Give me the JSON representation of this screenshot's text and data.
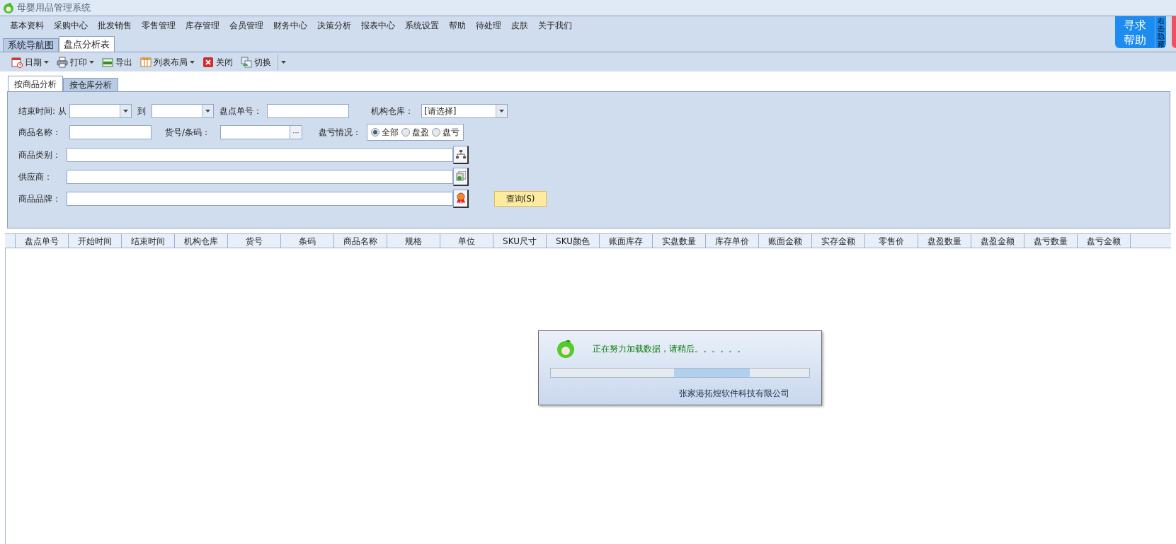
{
  "window": {
    "title": "母婴用品管理系统"
  },
  "menu": [
    "基本资料",
    "采购中心",
    "批发销售",
    "零售管理",
    "库存管理",
    "会员管理",
    "财务中心",
    "决策分析",
    "报表中心",
    "系统设置",
    "帮助",
    "待处理",
    "皮肤",
    "关于我们"
  ],
  "help_button": {
    "lines": [
      "寻求",
      "帮助"
    ],
    "hint": "右击隐藏"
  },
  "doc_tabs": [
    {
      "label": "系统导航图",
      "selected": false
    },
    {
      "label": "盘点分析表",
      "selected": true
    }
  ],
  "toolbar": [
    {
      "label": "日期",
      "kind": "calendar",
      "dropdown": true
    },
    {
      "label": "打印",
      "kind": "printer",
      "dropdown": true
    },
    {
      "label": "导出",
      "kind": "xls",
      "dropdown": false
    },
    {
      "label": "列表布局",
      "kind": "grid",
      "dropdown": true
    },
    {
      "label": "关闭",
      "kind": "close",
      "dropdown": false
    },
    {
      "label": "切换",
      "kind": "switch",
      "dropdown": false
    }
  ],
  "view_tabs": [
    {
      "label": "按商品分析",
      "selected": true
    },
    {
      "label": "按仓库分析",
      "selected": false
    }
  ],
  "filters": {
    "end_time": {
      "label": "结束时间: 从",
      "to_label": "到"
    },
    "count_no": {
      "label": "盘点单号："
    },
    "warehouse": {
      "label": "机构仓库：",
      "value": "[请选择]"
    },
    "product_name": {
      "label": "商品名称："
    },
    "code": {
      "label": "货号/条码：",
      "button": "···"
    },
    "profit_loss": {
      "label": "盘亏情况：",
      "options": [
        {
          "label": "全部",
          "selected": true
        },
        {
          "label": "盘盈",
          "selected": false
        },
        {
          "label": "盘亏",
          "selected": false
        }
      ]
    },
    "pickers": [
      {
        "label": "商品类别：",
        "kind": "tree"
      },
      {
        "label": "供应商：",
        "kind": "list"
      },
      {
        "label": "商品品牌：",
        "kind": "award"
      }
    ],
    "query_button": "查询(S)"
  },
  "table": {
    "columns": [
      "盘点单号",
      "开始时间",
      "结束时间",
      "机构仓库",
      "货号",
      "条码",
      "商品名称",
      "规格",
      "单位",
      "SKU尺寸",
      "SKU颜色",
      "账面库存",
      "实盘数量",
      "库存单价",
      "账面金额",
      "实存金额",
      "零售价",
      "盘盈数量",
      "盘盈金额",
      "盘亏数量",
      "盘亏金额"
    ]
  },
  "loading_dialog": {
    "message": "正在努力加载数据，请稍后。。。。。。",
    "progress": {
      "level": 0.77
    },
    "company": "张家港拓煌软件科技有限公司"
  }
}
